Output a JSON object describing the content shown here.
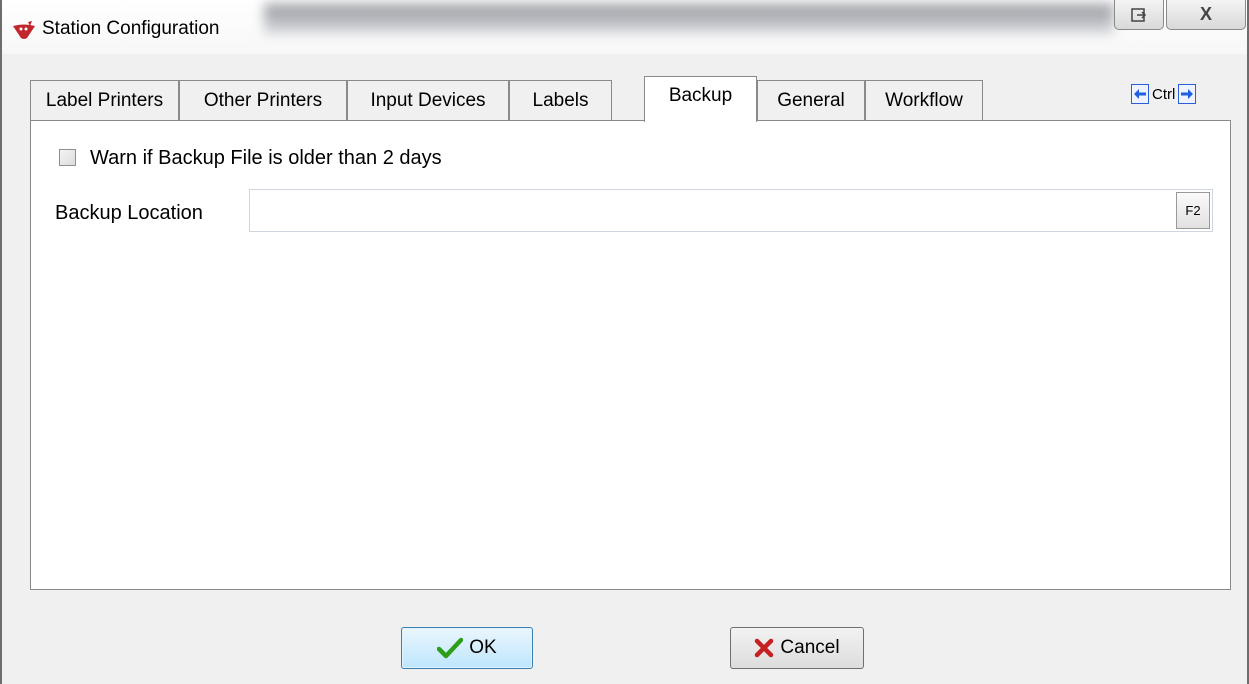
{
  "window": {
    "title": "Station Configuration",
    "close_label": "X"
  },
  "tabs": [
    {
      "label": "Label Printers",
      "active": false
    },
    {
      "label": "Other Printers",
      "active": false
    },
    {
      "label": "Input Devices",
      "active": false
    },
    {
      "label": "Labels",
      "active": false
    },
    {
      "label": "Backup",
      "active": true
    },
    {
      "label": "General",
      "active": false
    },
    {
      "label": "Workflow",
      "active": false
    }
  ],
  "tab_nav": {
    "ctrl_label": "Ctrl",
    "left_icon": "arrow-left-icon",
    "right_icon": "arrow-right-icon",
    "arrow_color": "#1f5fe0"
  },
  "backup": {
    "warn_checkbox_label": "Warn if Backup File is older than 2 days",
    "warn_checked": false,
    "location_label": "Backup Location",
    "location_value": "",
    "browse_label": "F2"
  },
  "footer": {
    "ok_label": "OK",
    "cancel_label": "Cancel",
    "ok_icon": "checkmark-icon",
    "cancel_icon": "x-icon",
    "ok_icon_color": "#2e9e1a",
    "cancel_icon_color": "#c62020"
  }
}
